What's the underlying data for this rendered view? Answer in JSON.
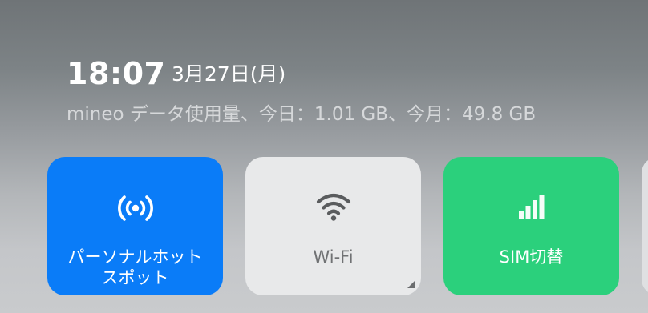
{
  "header": {
    "time": "18:07",
    "date": "3月27日(月)",
    "usage_text": "mineo データ使用量、今日：1.01 GB、今月：49.8 GB"
  },
  "tiles": [
    {
      "label_line1": "パーソナルホット",
      "label_line2": "スポット",
      "icon": "hotspot-icon",
      "state": "on",
      "color": "#0a7cf8"
    },
    {
      "label": "Wi-Fi",
      "icon": "wifi-icon",
      "state": "off",
      "color": "#e8e9ea"
    },
    {
      "label": "SIM切替",
      "icon": "signal-bars-icon",
      "state": "on",
      "color": "#2bd07c"
    }
  ]
}
